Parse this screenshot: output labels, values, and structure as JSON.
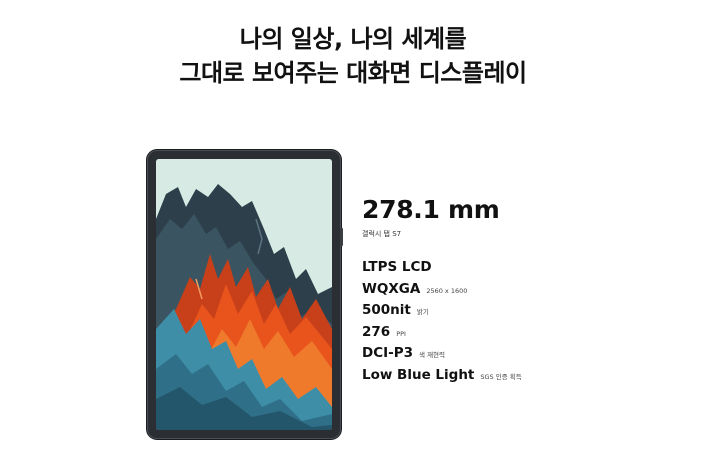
{
  "headline": {
    "line1": "나의 일상, 나의 세계를",
    "line2": "그대로 보여주는 대화면 디스플레이"
  },
  "spec": {
    "size": "278.1 mm",
    "model": "갤럭시 탭 S7",
    "items": [
      {
        "main": "LTPS LCD",
        "sub": ""
      },
      {
        "main": "WQXGA",
        "sub": "2560 x 1600"
      },
      {
        "main": "500nit",
        "sub": "밝기"
      },
      {
        "main": "276",
        "sub": "PPI"
      },
      {
        "main": "DCI-P3",
        "sub": "색 재현력"
      },
      {
        "main": "Low Blue Light",
        "sub": "SGS 인증 획득"
      }
    ]
  },
  "colors": {
    "bezel": "#2b2e33",
    "sky": "#d7ebe4",
    "orange": "#e8541c",
    "teal": "#3f8ea8",
    "dark": "#2c3f4a"
  }
}
